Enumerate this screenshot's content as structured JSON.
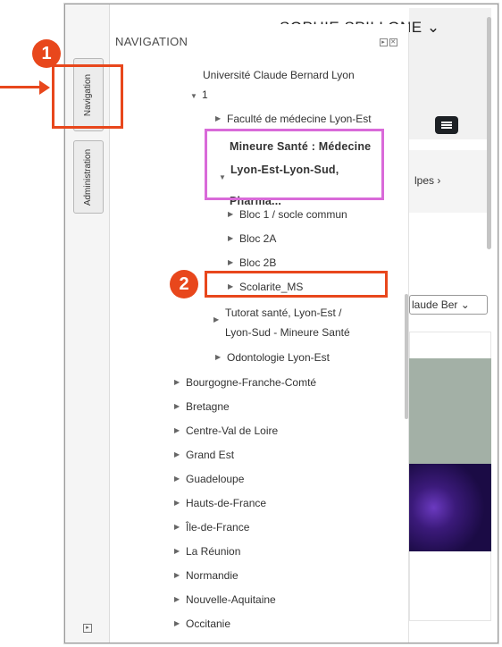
{
  "page": {
    "user_name": "SOPHIE SPILLONE ⌄",
    "breadcrumb_fragment": "lpes ›",
    "select_value": "laude Ber ⌄"
  },
  "dock": {
    "navigation_tab": "Navigation",
    "administration_tab": "Administration"
  },
  "block": {
    "title": "NAVIGATION"
  },
  "tree": {
    "university_line1": "Université Claude Bernard Lyon",
    "university_line2": "1",
    "faculty": "Faculté de médecine Lyon-Est",
    "mineure_line1": "Mineure Santé : Médecine",
    "mineure_line2": "Lyon-Est-Lyon-Sud,",
    "mineure_line3": "Pharma...",
    "bloc1": "Bloc 1 / socle commun",
    "bloc2a": "Bloc 2A",
    "bloc2b": "Bloc 2B",
    "scolarite": "Scolarite_MS",
    "tutorat_line1": "Tutorat santé, Lyon-Est /",
    "tutorat_line2": "Lyon-Sud - Mineure Santé",
    "odontologie": "Odontologie Lyon-Est",
    "regions": [
      "Bourgogne-Franche-Comté",
      "Bretagne",
      "Centre-Val de Loire",
      "Grand Est",
      "Guadeloupe",
      "Hauts-de-France",
      "Île-de-France",
      "La Réunion",
      "Normandie",
      "Nouvelle-Aquitaine",
      "Occitanie"
    ]
  },
  "annotations": {
    "badge1": "1",
    "badge2": "2"
  },
  "colors": {
    "annotation": "#e8471c",
    "highlight": "#d96ad9"
  }
}
